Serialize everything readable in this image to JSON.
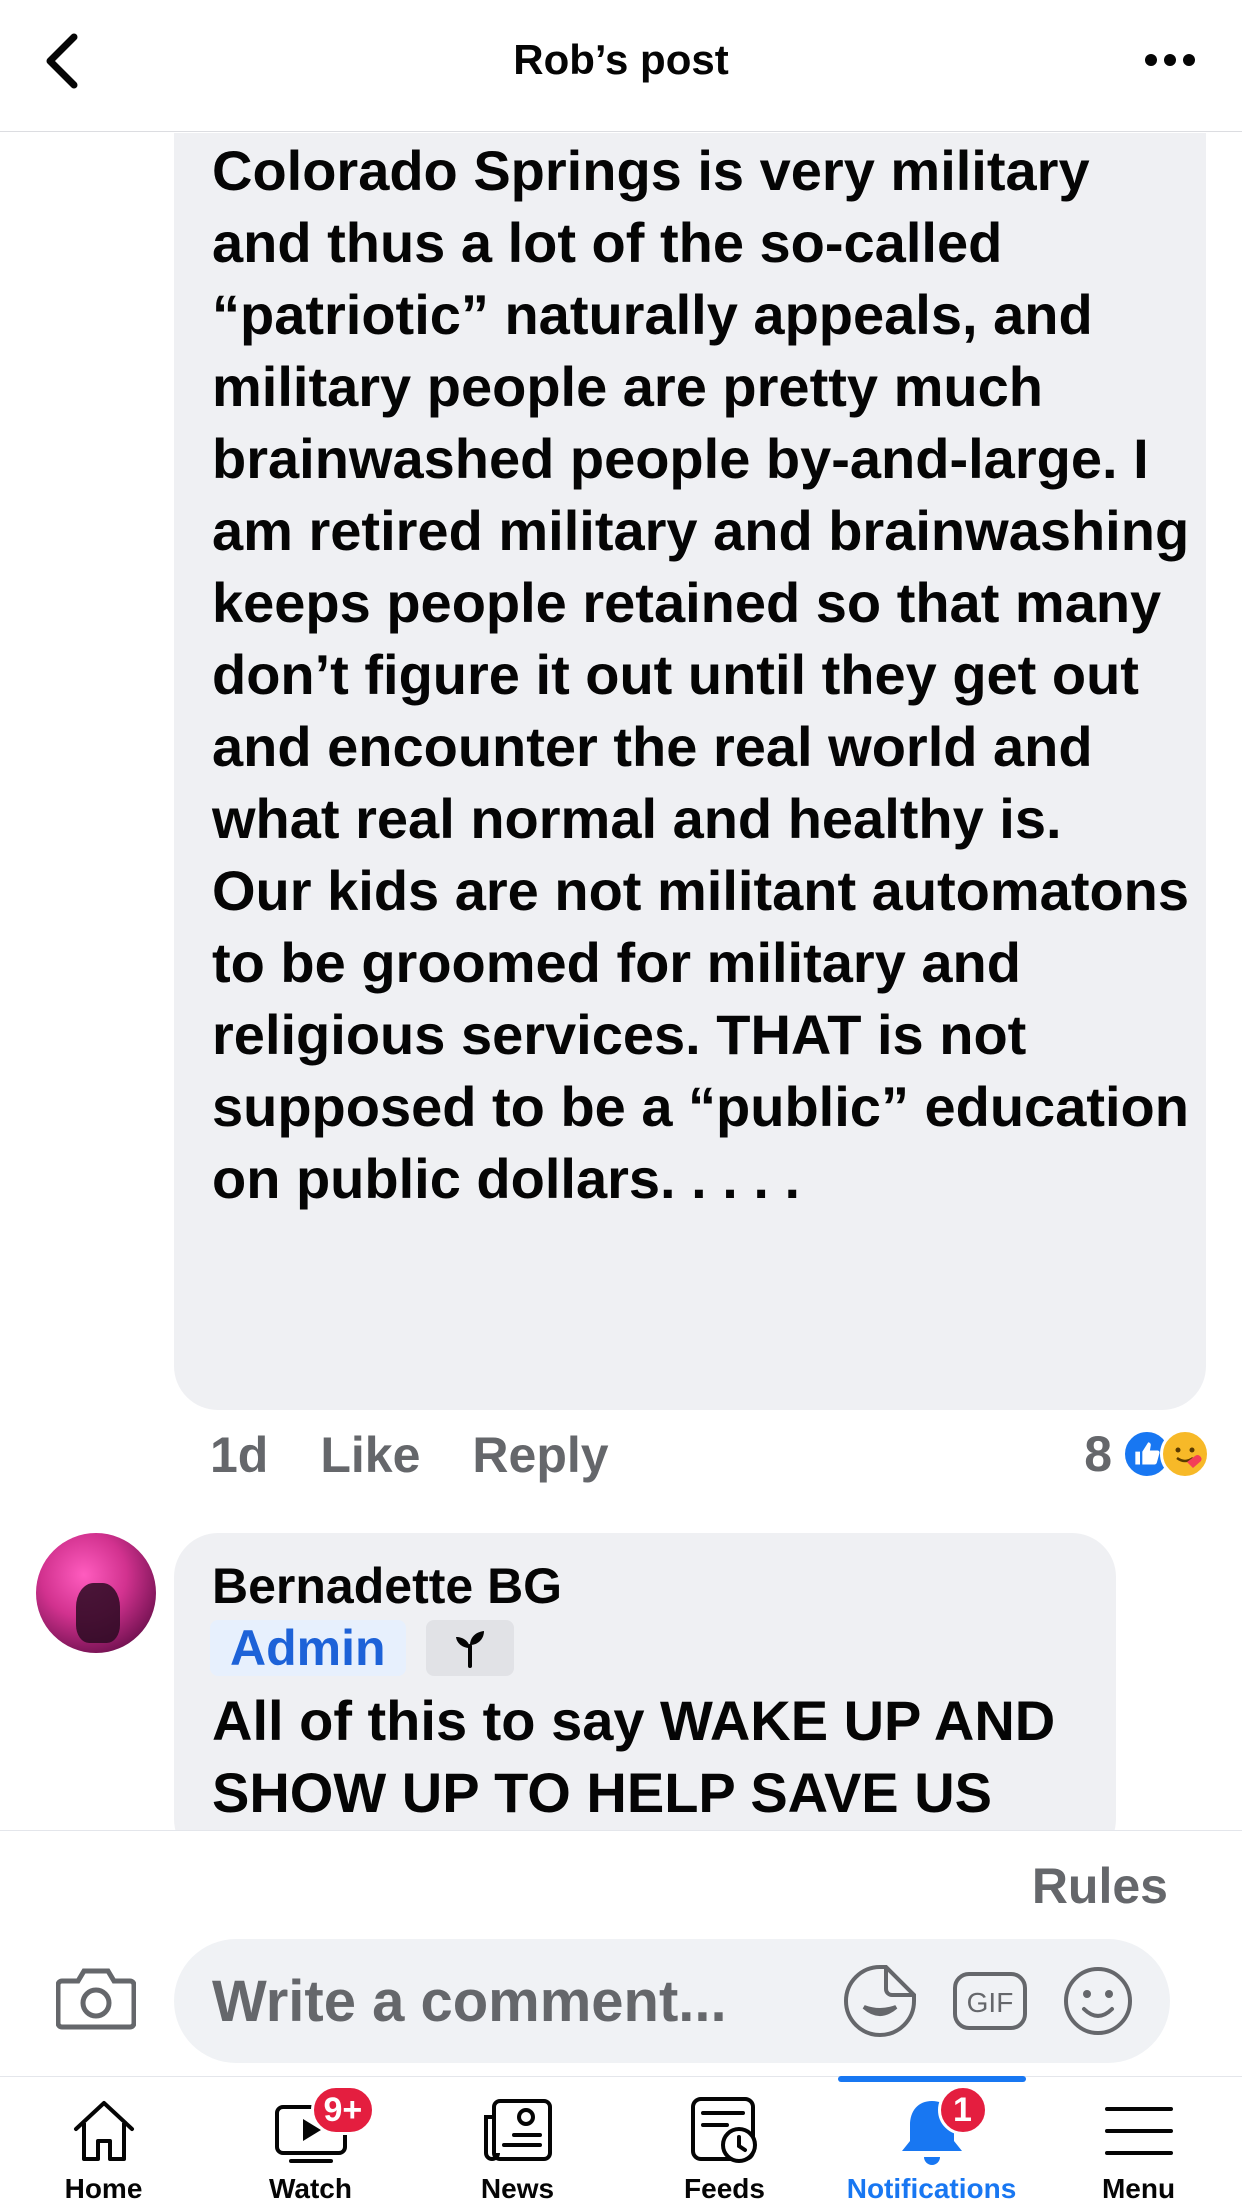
{
  "header": {
    "title": "Rob’s post"
  },
  "comment1": {
    "paragraph1": "Colorado Springs is very military and thus a lot of the so-called “patriotic” naturally appeals, and military people are pretty much brainwashed people by-and-large. I am retired military and brainwashing keeps people retained so that many don’t figure it out until they get out and encounter the real world and what real normal and healthy is.",
    "paragraph2": "Our kids are not militant automatons to be groomed for military and religious services. THAT is not supposed to be a “public” education on public dollars. . . . .",
    "time": "1d",
    "like_label": "Like",
    "reply_label": "Reply",
    "reaction_count": "8",
    "reaction_icons": [
      "like-reaction-icon",
      "care-reaction-icon"
    ]
  },
  "comment2": {
    "author": "Bernadette BG",
    "badge": "Admin",
    "badge_icon": "sprout-icon",
    "text": "All of this to say WAKE UP AND SHOW UP TO HELP SAVE US"
  },
  "composer": {
    "rules_label": "Rules",
    "placeholder": "Write a comment...",
    "gif_label": "GIF"
  },
  "tabs": [
    {
      "label": "Home",
      "icon": "home-icon",
      "badge": ""
    },
    {
      "label": "Watch",
      "icon": "watch-icon",
      "badge": "9+"
    },
    {
      "label": "News",
      "icon": "news-icon",
      "badge": ""
    },
    {
      "label": "Feeds",
      "icon": "feeds-icon",
      "badge": ""
    },
    {
      "label": "Notifications",
      "icon": "bell-icon",
      "badge": "1",
      "active": true
    },
    {
      "label": "Menu",
      "icon": "menu-icon",
      "badge": ""
    }
  ],
  "colors": {
    "accent": "#1877f2",
    "badge_red": "#e41e3f",
    "bubble_bg": "#eff0f3",
    "secondary_text": "#65676b"
  }
}
